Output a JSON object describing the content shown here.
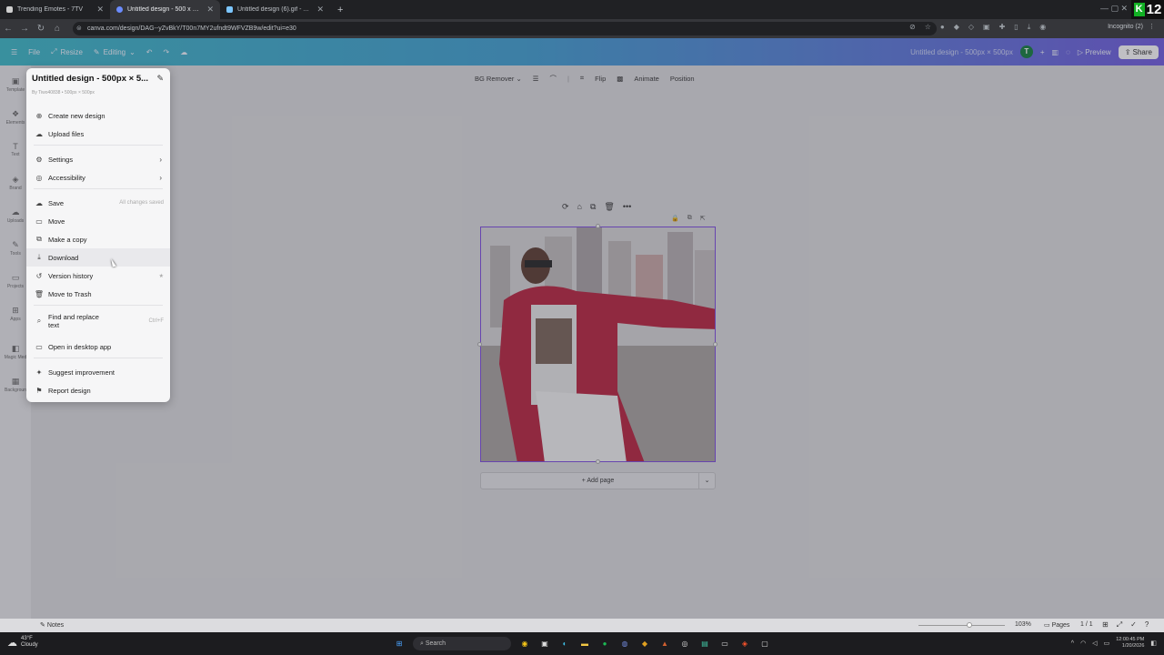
{
  "browser": {
    "tabs": [
      {
        "title": "Trending Emotes - 7TV",
        "active": false,
        "fav_color": "#cfcfcf"
      },
      {
        "title": "Untitled design - 500 x 500px",
        "active": true,
        "fav_color": "#6b8cff"
      },
      {
        "title": "Untitled design (6).gif - Animat",
        "active": false,
        "fav_color": "#7cc6ff"
      }
    ],
    "new_tab": "+",
    "url": "canva.com/design/DAG--yZvBkY/T00n7MY2ufndt9WFVZB9w/edit?ui=e30",
    "incognito": "Incognito (2)",
    "k_badge": "K",
    "k_number": "12",
    "window_controls": "—   ▢   ✕"
  },
  "canva_header": {
    "menu_icon": "☰",
    "file": "File",
    "resize": "Resize",
    "editing": "Editing",
    "design_title": "Untitled design - 500px × 500px",
    "avatar": "T",
    "preview": "Preview",
    "share": "Share"
  },
  "rail": [
    {
      "icon": "▣",
      "label": "Template"
    },
    {
      "icon": "❖",
      "label": "Elements"
    },
    {
      "icon": "T",
      "label": "Text"
    },
    {
      "icon": "◈",
      "label": "Brand"
    },
    {
      "icon": "☁",
      "label": "Uploads"
    },
    {
      "icon": "✎",
      "label": "Tools"
    },
    {
      "icon": "▭",
      "label": "Projects"
    },
    {
      "icon": "⊞",
      "label": "Apps"
    },
    {
      "icon": "◧",
      "label": "Magic Med"
    },
    {
      "icon": "▦",
      "label": "Backgroun"
    }
  ],
  "context_toolbar": {
    "bg_remover": "BG Remover",
    "flip": "Flip",
    "animate": "Animate",
    "position": "Position"
  },
  "file_menu": {
    "title": "Untitled design - 500px × 5...",
    "subtitle": "By Tiwo40838 • 500px × 500px",
    "items": [
      {
        "label": "Create new design",
        "icon": "⊕",
        "aux": "",
        "chev": ""
      },
      {
        "label": "Upload files",
        "icon": "☁",
        "aux": "",
        "chev": ""
      },
      {
        "label": "Settings",
        "icon": "⚙",
        "aux": "",
        "chev": "›"
      },
      {
        "label": "Accessibility",
        "icon": "◎",
        "aux": "",
        "chev": "›"
      },
      {
        "label": "Save",
        "icon": "☁",
        "aux": "All changes saved",
        "chev": ""
      },
      {
        "label": "Move",
        "icon": "▭",
        "aux": "",
        "chev": ""
      },
      {
        "label": "Make a copy",
        "icon": "⧉",
        "aux": "",
        "chev": ""
      },
      {
        "label": "Download",
        "icon": "⤓",
        "aux": "",
        "chev": ""
      },
      {
        "label": "Version history",
        "icon": "↺",
        "aux": "★",
        "chev": ""
      },
      {
        "label": "Move to Trash",
        "icon": "🗑",
        "aux": "",
        "chev": ""
      },
      {
        "label": "Find and replace text",
        "icon": "⌕",
        "aux": "Ctrl+F",
        "chev": ""
      },
      {
        "label": "Open in desktop app",
        "icon": "▭",
        "aux": "",
        "chev": ""
      },
      {
        "label": "Suggest improvement",
        "icon": "✦",
        "aux": "",
        "chev": ""
      },
      {
        "label": "Report design",
        "icon": "⚑",
        "aux": "",
        "chev": ""
      }
    ]
  },
  "add_page": "+ Add page",
  "footer": {
    "notes": "Notes",
    "zoom": "103%",
    "pages": "Pages",
    "page_number": "1 / 1"
  },
  "taskbar": {
    "weather_temp": "43°F",
    "weather_cond": "Cloudy",
    "search": "Search",
    "time": "12:00:45 PM",
    "date": "1/20/2026"
  }
}
